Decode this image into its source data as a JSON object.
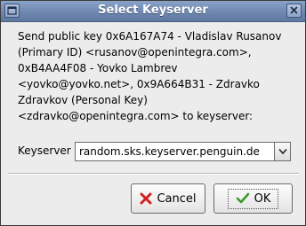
{
  "window": {
    "title": "Select Keyserver",
    "menu_icon": "window-menu-icon",
    "close_icon": "close-icon"
  },
  "message": {
    "lines": [
      "Send public key 0x6A167A74 - Vladislav Rusanov",
      "(Primary ID) <rusanov@openintegra.com>,",
      "0xB4AA4F08 - Yovko Lambrev",
      "<yovko@yovko.net>, 0x9A664B31 - Zdravko",
      "Zdravkov (Personal Key)",
      "<zdravko@openintegra.com> to keyserver:"
    ]
  },
  "keyserver": {
    "label": "Keyserver",
    "value": "random.sks.keyserver.penguin.de",
    "dropdown_icon": "chevron-down-icon"
  },
  "buttons": {
    "cancel_label": "Cancel",
    "cancel_icon": "cancel-x-icon",
    "ok_label": "OK",
    "ok_icon": "checkmark-icon"
  },
  "colors": {
    "titlebar": "#6f88b0",
    "cancel_icon": "#d02020",
    "ok_icon": "#3a9a2a"
  }
}
